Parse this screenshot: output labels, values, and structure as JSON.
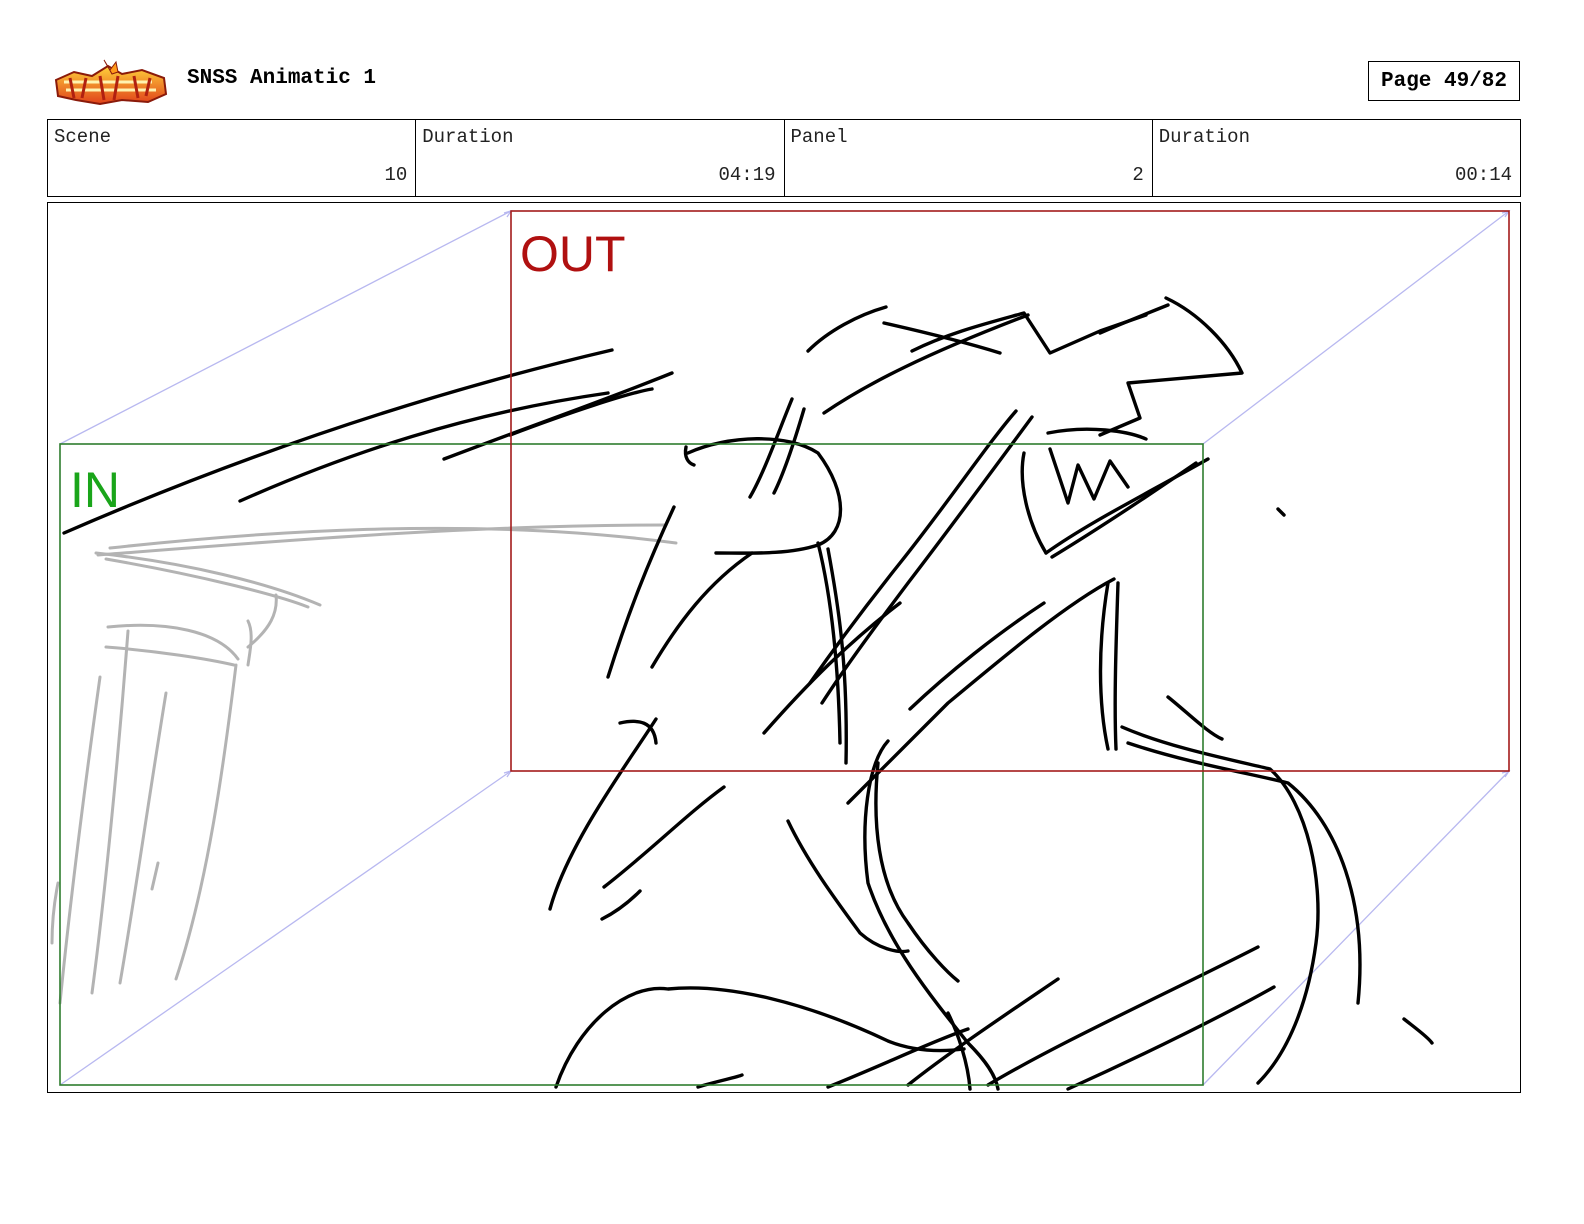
{
  "header": {
    "project_title": "SNSS Animatic 1",
    "page_label": "Page 49/82"
  },
  "info": {
    "scene_label": "Scene",
    "scene_value": "10",
    "duration_label": "Duration",
    "duration_value": "04:19",
    "panel_label": "Panel",
    "panel_value": "2",
    "panel_duration_label": "Duration",
    "panel_duration_value": "00:14"
  },
  "panel": {
    "in_label": "IN",
    "out_label": "OUT",
    "in_color": "#2e7d2e",
    "out_color": "#a31b1b",
    "in_text_color": "#1aa51a",
    "out_text_color": "#b01010"
  }
}
